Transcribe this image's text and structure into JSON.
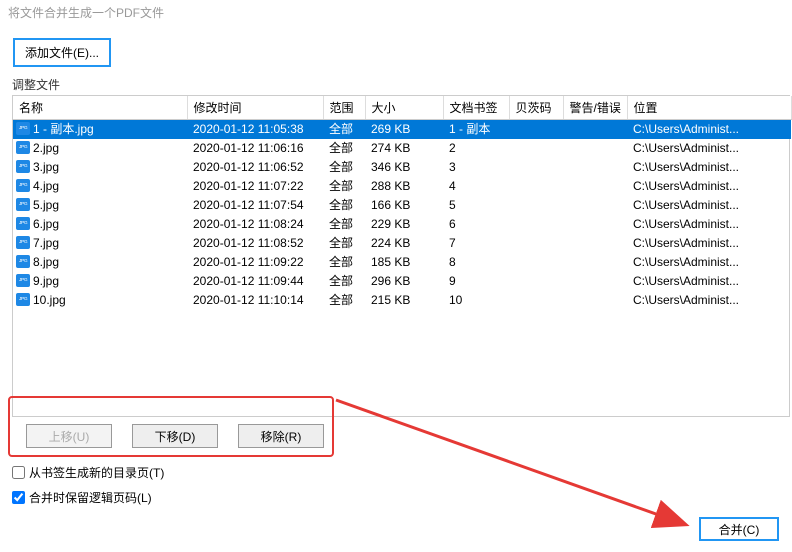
{
  "title": "将文件合并生成一个PDF文件",
  "add_button": "添加文件(E)...",
  "group_label": "调整文件",
  "columns": {
    "name": "名称",
    "mtime": "修改时间",
    "range": "范围",
    "size": "大小",
    "bookmark": "文档书签",
    "pages": "贝茨码",
    "warn": "警告/错误",
    "loc": "位置"
  },
  "rows": [
    {
      "name": "1 - 副本.jpg",
      "mtime": "2020-01-12 11:05:38",
      "range": "全部",
      "size": "269 KB",
      "bookmark": "1 - 副本",
      "pages": "",
      "warn": "",
      "loc": "C:\\Users\\Administ..."
    },
    {
      "name": "2.jpg",
      "mtime": "2020-01-12 11:06:16",
      "range": "全部",
      "size": "274 KB",
      "bookmark": "2",
      "pages": "",
      "warn": "",
      "loc": "C:\\Users\\Administ..."
    },
    {
      "name": "3.jpg",
      "mtime": "2020-01-12 11:06:52",
      "range": "全部",
      "size": "346 KB",
      "bookmark": "3",
      "pages": "",
      "warn": "",
      "loc": "C:\\Users\\Administ..."
    },
    {
      "name": "4.jpg",
      "mtime": "2020-01-12 11:07:22",
      "range": "全部",
      "size": "288 KB",
      "bookmark": "4",
      "pages": "",
      "warn": "",
      "loc": "C:\\Users\\Administ..."
    },
    {
      "name": "5.jpg",
      "mtime": "2020-01-12 11:07:54",
      "range": "全部",
      "size": "166 KB",
      "bookmark": "5",
      "pages": "",
      "warn": "",
      "loc": "C:\\Users\\Administ..."
    },
    {
      "name": "6.jpg",
      "mtime": "2020-01-12 11:08:24",
      "range": "全部",
      "size": "229 KB",
      "bookmark": "6",
      "pages": "",
      "warn": "",
      "loc": "C:\\Users\\Administ..."
    },
    {
      "name": "7.jpg",
      "mtime": "2020-01-12 11:08:52",
      "range": "全部",
      "size": "224 KB",
      "bookmark": "7",
      "pages": "",
      "warn": "",
      "loc": "C:\\Users\\Administ..."
    },
    {
      "name": "8.jpg",
      "mtime": "2020-01-12 11:09:22",
      "range": "全部",
      "size": "185 KB",
      "bookmark": "8",
      "pages": "",
      "warn": "",
      "loc": "C:\\Users\\Administ..."
    },
    {
      "name": "9.jpg",
      "mtime": "2020-01-12 11:09:44",
      "range": "全部",
      "size": "296 KB",
      "bookmark": "9",
      "pages": "",
      "warn": "",
      "loc": "C:\\Users\\Administ..."
    },
    {
      "name": "10.jpg",
      "mtime": "2020-01-12 11:10:14",
      "range": "全部",
      "size": "215 KB",
      "bookmark": "10",
      "pages": "",
      "warn": "",
      "loc": "C:\\Users\\Administ..."
    }
  ],
  "buttons": {
    "up": "上移(U)",
    "down": "下移(D)",
    "remove": "移除(R)"
  },
  "check1": "从书签生成新的目录页(T)",
  "check1_checked": false,
  "check2": "合并时保留逻辑页码(L)",
  "check2_checked": true,
  "merge": "合并(C)"
}
